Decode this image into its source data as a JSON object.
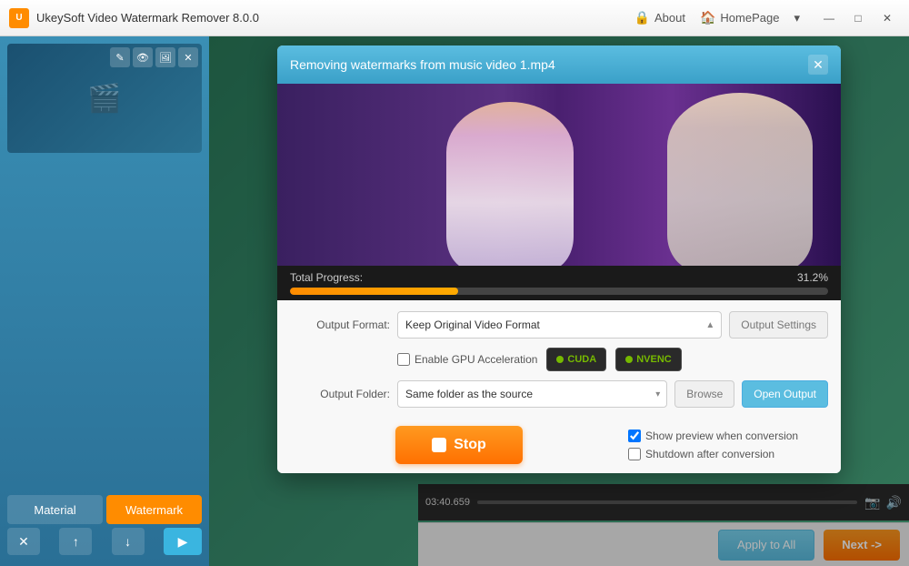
{
  "titleBar": {
    "appName": "UkeySoft Video Watermark Remover 8.0.0",
    "logoText": "U",
    "nav": [
      {
        "id": "about",
        "icon": "🔒",
        "label": "About"
      },
      {
        "id": "homepage",
        "icon": "🏠",
        "label": "HomePage"
      }
    ],
    "controls": {
      "minimize": "—",
      "maximize": "□",
      "close": "✕"
    }
  },
  "sidebar": {
    "tabs": [
      {
        "id": "material",
        "label": "Material",
        "active": false
      },
      {
        "id": "watermark",
        "label": "Watermark",
        "active": true
      }
    ],
    "actions": {
      "delete": "✕",
      "up": "↑",
      "down": "↓",
      "play": "▶"
    }
  },
  "dialog": {
    "title": "Removing watermarks from music video 1.mp4",
    "closeBtn": "✕",
    "progress": {
      "label": "Total Progress:",
      "percent": 31.2,
      "percentText": "31.2%",
      "barWidth": "31.2%"
    },
    "outputFormat": {
      "label": "Output Format:",
      "value": "Keep Original Video Format",
      "placeholder": "Keep Original Video Format",
      "settingsBtnLabel": "Output Settings"
    },
    "gpu": {
      "checkboxLabel": "Enable GPU Acceleration",
      "cudaLabel": "CUDA",
      "nvencLabel": "NVENC"
    },
    "outputFolder": {
      "label": "Output Folder:",
      "value": "Same folder as the source",
      "browseBtnLabel": "Browse",
      "openOutputBtnLabel": "Open Output"
    },
    "stopBtn": "Stop",
    "rightOptions": {
      "showPreviewLabel": "Show preview when conversion",
      "showPreviewChecked": true,
      "shutdownLabel": "Shutdown after conversion",
      "shutdownChecked": false
    }
  },
  "bottomBar": {
    "applyLabel": "Apply to All",
    "nextLabel": "Next ->"
  },
  "timeline": {
    "time": "03:40.659"
  }
}
